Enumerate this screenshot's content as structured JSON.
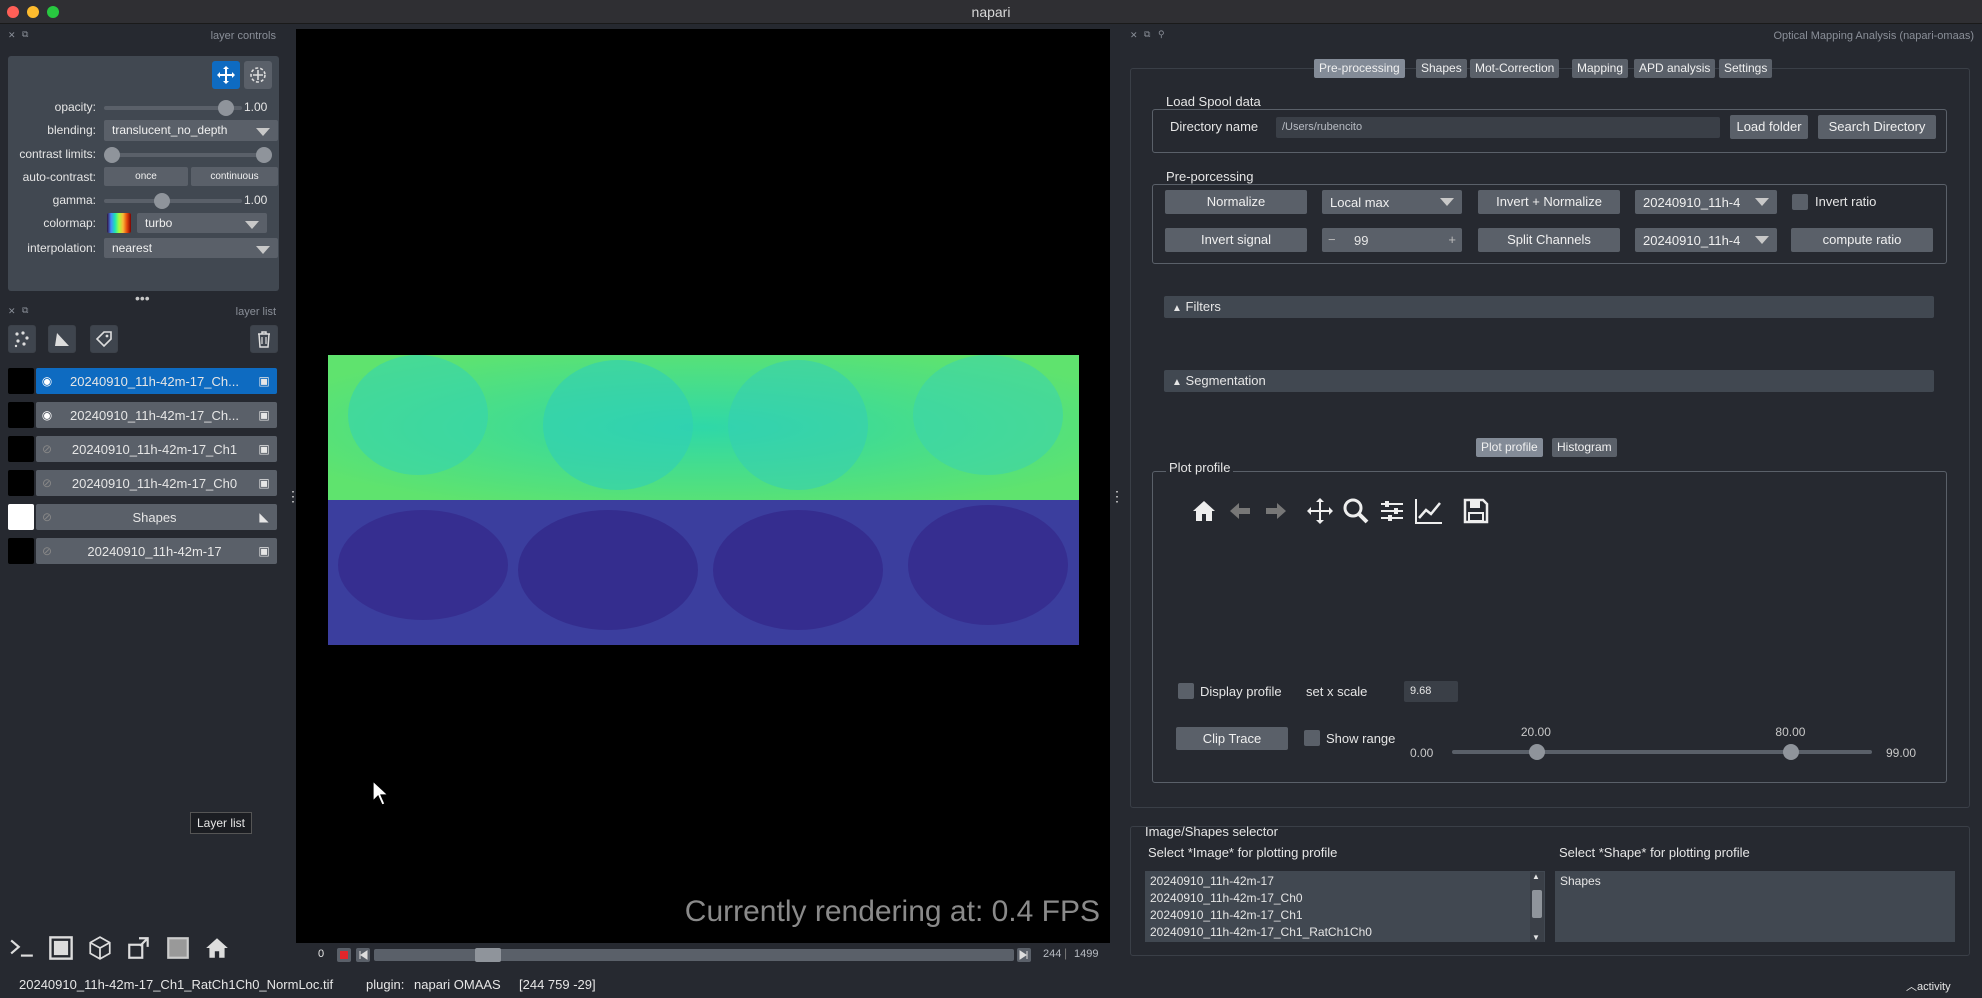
{
  "window": {
    "title": "napari"
  },
  "layer_controls": {
    "header": "layer controls",
    "opacity_label": "opacity:",
    "opacity_value": "1.00",
    "opacity": 1.0,
    "blending_label": "blending:",
    "blending_value": "translucent_no_depth",
    "contrast_label": "contrast limits:",
    "autocontrast_label": "auto-contrast:",
    "once_label": "once",
    "continuous_label": "continuous",
    "gamma_label": "gamma:",
    "gamma_value": "1.00",
    "colormap_label": "colormap:",
    "colormap_value": "turbo",
    "interpolation_label": "interpolation:",
    "interpolation_value": "nearest"
  },
  "layer_list": {
    "header": "layer list",
    "layers": [
      {
        "name": "20240910_11h-42m-17_Ch...",
        "visible": true,
        "selected": true,
        "type": "image"
      },
      {
        "name": "20240910_11h-42m-17_Ch...",
        "visible": true,
        "selected": false,
        "type": "image"
      },
      {
        "name": "20240910_11h-42m-17_Ch1",
        "visible": false,
        "selected": false,
        "type": "image"
      },
      {
        "name": "20240910_11h-42m-17_Ch0",
        "visible": false,
        "selected": false,
        "type": "image"
      },
      {
        "name": "Shapes",
        "visible": false,
        "selected": false,
        "type": "shapes"
      },
      {
        "name": "20240910_11h-42m-17",
        "visible": false,
        "selected": false,
        "type": "image"
      }
    ],
    "tooltip": "Layer list"
  },
  "canvas": {
    "fps_text": "Currently rendering at: 0.4 FPS"
  },
  "dims": {
    "start": "0",
    "current": "244",
    "max": "1499"
  },
  "status": {
    "file": "20240910_11h-42m-17_Ch1_RatCh1Ch0_NormLoc.tif",
    "plugin_label": "plugin:",
    "plugin": "napari OMAAS",
    "coords": "[244 759 -29]",
    "activity": "activity"
  },
  "plugin": {
    "title": "Optical Mapping Analysis (napari-omaas)",
    "tabs": [
      "Pre-processing",
      "Shapes",
      "Mot-Correction",
      "Mapping",
      "APD analysis",
      "Settings"
    ],
    "active_tab": 0,
    "load_spool": {
      "title": "Load Spool data",
      "dir_label": "Directory name",
      "dir_value": "/Users/rubencito",
      "load_btn": "Load folder",
      "search_btn": "Search Directory"
    },
    "preproc": {
      "title": "Pre-porcessing",
      "normalize": "Normalize",
      "local_max": "Local max",
      "invert_normalize": "Invert + Normalize",
      "combo1": "20240910_11h-4",
      "invert_ratio": "Invert ratio",
      "invert_signal": "Invert signal",
      "spin_value": "99",
      "minus": "−",
      "plus": "+",
      "split": "Split Channels",
      "combo2": "20240910_11h-4",
      "compute_ratio": "compute ratio"
    },
    "filters": "Filters",
    "segmentation": "Segmentation",
    "plot_tabs": [
      "Plot profile",
      "Histogram"
    ],
    "plot_profile": {
      "title": "Plot profile",
      "display_profile": "Display profile",
      "set_x_scale": "set x scale",
      "x_scale": "9.68",
      "clip_trace": "Clip Trace",
      "show_range": "Show range",
      "range_min": "0.00",
      "range_max": "99.00",
      "low": "20.00",
      "high": "80.00",
      "low_value": 20,
      "high_value": 80,
      "max_value": 99
    }
  },
  "selector": {
    "title": "Image/Shapes selector",
    "image_label": "Select *Image* for plotting profile",
    "shape_label": "Select *Shape* for plotting profile",
    "images": [
      "20240910_11h-42m-17",
      "20240910_11h-42m-17_Ch0",
      "20240910_11h-42m-17_Ch1",
      "20240910_11h-42m-17_Ch1_RatCh1Ch0"
    ],
    "shapes": [
      "Shapes"
    ]
  }
}
